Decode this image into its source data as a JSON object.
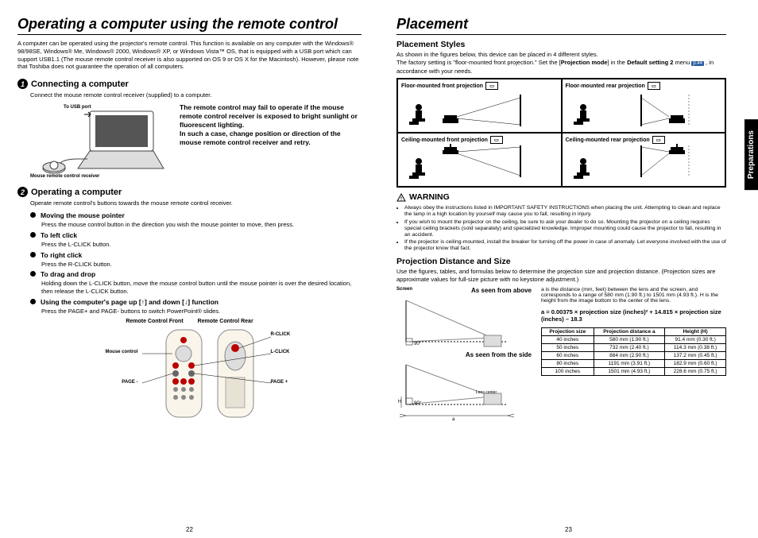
{
  "left": {
    "title": "Operating a computer using the remote control",
    "intro": "A computer can be operated using the projector's remote control. This function is available on any computer with the Windows® 98/98SE, Windows® Me, Windows® 2000, Windows® XP, or Windows Vista™ OS, that is equipped with a USB port which can support USB1.1 (The mouse remote control receiver is also supported on OS 9 or OS X for the Macintosh). However, please note that Toshiba does not guarantee the operation of all computers.",
    "step1_title": "Connecting a computer",
    "step1_desc": "Connect the mouse remote control receiver (supplied) to a computer.",
    "usb_label": "To USB port",
    "receiver_label": "Mouse remote control receiver",
    "warn_text1": "The remote control may fail to operate if the mouse remote control receiver is exposed to bright sunlight or fluorescent lighting.",
    "warn_text2": "In such a case, change position or direction of the mouse remote control receiver and retry.",
    "step2_title": "Operating a computer",
    "step2_desc": "Operate remote control's buttons towards the mouse remote control receiver.",
    "bullets": [
      {
        "t": "Moving the mouse pointer",
        "d": "Press the mouse control button in the direction you wish the mouse pointer to move, then press."
      },
      {
        "t": "To left click",
        "d": "Press the L-CLICK button."
      },
      {
        "t": "To right click",
        "d": "Press the R-CLICK button."
      },
      {
        "t": "To drag and drop",
        "d": "Holding down the L-CLICK button, move the mouse control button until the mouse pointer is over the desired location, then release the L-CLICK button."
      },
      {
        "t": "Using the computer's page up [↑] and down [↓] function",
        "d": "Press the PAGE+ and PAGE- buttons to switch PowerPoint® slides."
      }
    ],
    "remote_front": "Remote Control Front",
    "remote_rear": "Remote Control Rear",
    "rc_rclick": "R-CLICK",
    "rc_lclick": "L-CLICK",
    "rc_mouse": "Mouse control",
    "rc_pageplus": "PAGE +",
    "rc_pageminus": "PAGE -",
    "page": "22"
  },
  "right": {
    "title": "Placement",
    "ps_title": "Placement Styles",
    "ps_text1": "As shown in the figures below, this device can be placed in 4 different styles.",
    "ps_text2a": "The factory setting is \"floor-mounted front projection.\" Set the [",
    "ps_text2b": "Projection mode",
    "ps_text2c": "] in the ",
    "ps_text2d": "Default setting 2",
    "ps_text2e": " menu ",
    "ps_pageref": "p.44",
    "ps_text2f": " , in accordance with your needs.",
    "placements": [
      "Floor-mounted front projection",
      "Floor-mounted rear projection",
      "Ceiling-mounted front projection",
      "Ceiling-mounted rear projection"
    ],
    "warn_title": "WARNING",
    "warnings": [
      "Always obey the instructions listed in IMPORTANT SAFETY INSTRUCTIONS when placing the unit. Attempting to clean and replace the lamp in a high location by yourself may cause you to fall, resulting in injury.",
      "If you wish to mount the projector on the ceiling, be sure to ask your dealer to do so. Mounting the projector on a ceiling requires special ceiling brackets (sold separately) and specialized knowledge. Improper mounting could cause the projector to fall, resulting in an accident.",
      "If the projector is ceiling-mounted, install the breaker for turning off the power in case of anomaly. Let everyone involved with the use of the projector know that fact."
    ],
    "pd_title": "Projection Distance and Size",
    "pd_text": "Use the figures, tables, and formulas below to determine the projection size and projection distance. (Projection sizes are approximate values for full-size picture with no keystone adjustment.)",
    "screen_label": "Screen",
    "above_label": "As seen from above",
    "side_label": "As seen from the side",
    "lens_label": "Lens center",
    "h_label": "H",
    "a_label": "a",
    "deg_label": "90°",
    "a_desc": "a is the distance (mm, feet) between the lens and the screen, and corresponds to a range of 580 mm (1.90 ft.) to 1501 mm (4.93 ft.). H is the height from the image bottom to the center of the lens.",
    "formula": "a = 0.00375 × projection size (inches)² + 14.815 × projection size (inches) – 18.3",
    "th1": "Projection size",
    "th2": "Projection distance a",
    "th3": "Height (H)",
    "rows": [
      [
        "40 inches",
        "580 mm (1.90 ft.)",
        "91.4 mm (0.30 ft.)"
      ],
      [
        "50 inches",
        "732 mm (2.40 ft.)",
        "114.3 mm (0.38 ft.)"
      ],
      [
        "60 inches",
        "884 mm (2.90 ft.)",
        "137.2 mm (0.45 ft.)"
      ],
      [
        "80 inches",
        "1191 mm (3.91 ft.)",
        "182.9 mm (0.60 ft.)"
      ],
      [
        "100 inches",
        "1501 mm (4.93 ft.)",
        "228.6 mm (0.75 ft.)"
      ]
    ],
    "sidetab": "Preparations",
    "page": "23"
  }
}
